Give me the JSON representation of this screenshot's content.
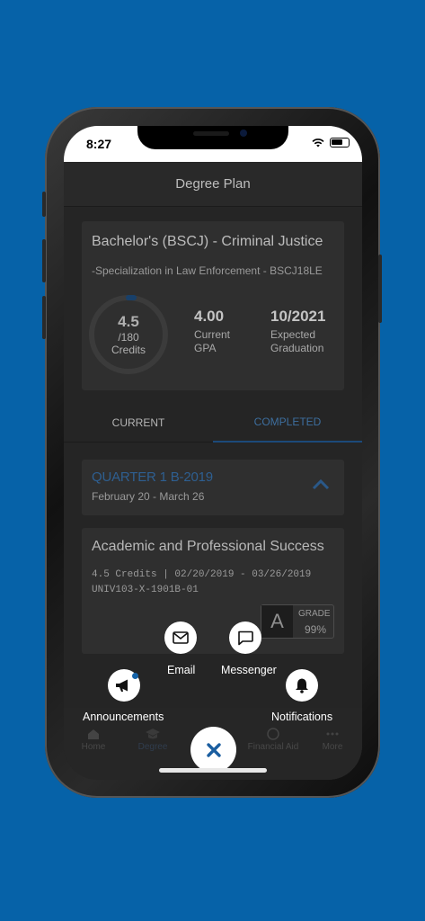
{
  "status_bar": {
    "time": "8:27"
  },
  "navbar": {
    "title": "Degree Plan"
  },
  "degree": {
    "title": "Bachelor's (BSCJ) - Criminal Justice",
    "specialization": "-Specialization in Law Enforcement - BSCJ18LE",
    "credits_earned": "4.5",
    "credits_total": "/180",
    "credits_label": "Credits",
    "credits_progress_fraction": 0.025,
    "gpa_value": "4.00",
    "gpa_label_1": "Current",
    "gpa_label_2": "GPA",
    "grad_value": "10/2021",
    "grad_label_1": "Expected",
    "grad_label_2": "Graduation"
  },
  "tabs": {
    "current": "CURRENT",
    "completed": "COMPLETED",
    "selected": "COMPLETED"
  },
  "quarter": {
    "title": "QUARTER 1 B-2019",
    "dates": "February 20 - March 26"
  },
  "course": {
    "title": "Academic and Professional Success",
    "meta_line1": "4.5 Credits | 02/20/2019 - 03/26/2019",
    "meta_line2": "UNIV103-X-1901B-01",
    "grade_letter": "A",
    "grade_label": "GRADE",
    "grade_percent": "99%"
  },
  "tabbar": {
    "home": "Home",
    "degree": "Degree",
    "financial_aid": "Financial Aid",
    "more": "More"
  },
  "fab_menu": {
    "email": "Email",
    "messenger": "Messenger",
    "announcements": "Announcements",
    "notifications": "Notifications"
  },
  "colors": {
    "background": "#0662a8",
    "accent": "#1563a8",
    "fab_icon": "#1b5ea0"
  }
}
